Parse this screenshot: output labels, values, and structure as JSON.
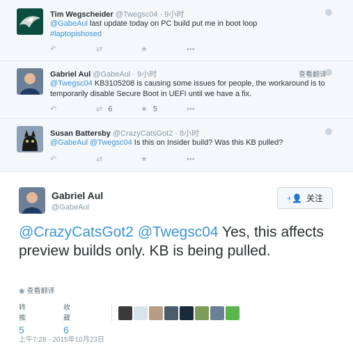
{
  "replies": [
    {
      "name": "Tim Wegscheider",
      "screen_name": "@Twegsc04",
      "time": "9小时",
      "text_mention": "@GabeAul",
      "text_body": " last update today on PC build put me in boot loop",
      "hashtag": "#laptopishosed",
      "retweets": "",
      "favorites": ""
    },
    {
      "name": "Gabriel Aul",
      "screen_name": "@GabeAul",
      "time": "9小时",
      "translate_label": "查看翻译",
      "text_mention": "@Twegsc04",
      "text_body": " KB3105208 is causing some issues for people, the workaround is to temporarily disable Secure Boot in UEFI until we have a fix.",
      "retweets": "6",
      "favorites": "5"
    },
    {
      "name": "Susan Battersby",
      "screen_name": "@CrazyCatsGot2",
      "time": "8小时",
      "text_mention_1": "@GabeAul",
      "text_mention_2": "@Twegsc04",
      "text_body": " Is this on Insider build? Was this KB pulled?",
      "retweets": "",
      "favorites": ""
    }
  ],
  "main_tweet": {
    "name": "Gabriel Aul",
    "screen_name": "@GabeAul",
    "follow_label": "关注",
    "mention_1": "@CrazyCatsGot2",
    "mention_2": "@Twegsc04",
    "body": " Yes, this affects preview builds only. KB is being pulled.",
    "translate_label": "查看翻译",
    "retweets_label": "转推",
    "retweets_value": "5",
    "favorites_label": "收藏",
    "favorites_value": "6",
    "timestamp": "上午7:28 - 2015年10月23日"
  },
  "icons": {
    "reply": "reply-icon",
    "retweet": "retweet-icon",
    "favorite": "star-icon",
    "more": "more-icon",
    "globe": "globe-icon",
    "follow": "add-user-icon"
  },
  "colors": {
    "link": "#3b94d9",
    "background": "#f5f8fa",
    "muted": "#8899a6"
  }
}
